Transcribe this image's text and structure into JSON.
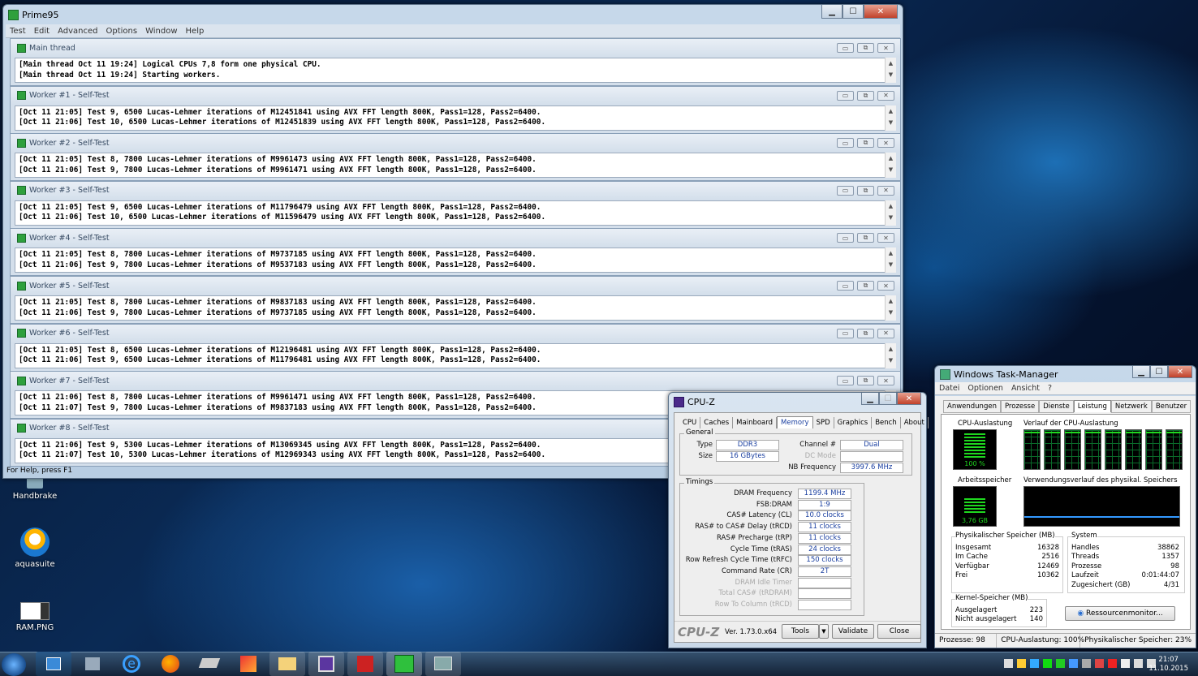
{
  "prime95": {
    "title": "Prime95",
    "menu": [
      "Test",
      "Edit",
      "Advanced",
      "Options",
      "Window",
      "Help"
    ],
    "status": "For Help, press F1",
    "panes": [
      {
        "title": "Main thread",
        "lines": [
          "[Main thread Oct 11 19:24] Logical CPUs 7,8 form one physical CPU.",
          "[Main thread Oct 11 19:24] Starting workers."
        ]
      },
      {
        "title": "Worker #1 - Self-Test",
        "lines": [
          "[Oct 11 21:05] Test 9, 6500 Lucas-Lehmer iterations of M12451841 using AVX FFT length 800K, Pass1=128, Pass2=6400.",
          "[Oct 11 21:06] Test 10, 6500 Lucas-Lehmer iterations of M12451839 using AVX FFT length 800K, Pass1=128, Pass2=6400."
        ]
      },
      {
        "title": "Worker #2 - Self-Test",
        "lines": [
          "[Oct 11 21:05] Test 8, 7800 Lucas-Lehmer iterations of M9961473 using AVX FFT length 800K, Pass1=128, Pass2=6400.",
          "[Oct 11 21:06] Test 9, 7800 Lucas-Lehmer iterations of M9961471 using AVX FFT length 800K, Pass1=128, Pass2=6400."
        ]
      },
      {
        "title": "Worker #3 - Self-Test",
        "lines": [
          "[Oct 11 21:05] Test 9, 6500 Lucas-Lehmer iterations of M11796479 using AVX FFT length 800K, Pass1=128, Pass2=6400.",
          "[Oct 11 21:06] Test 10, 6500 Lucas-Lehmer iterations of M11596479 using AVX FFT length 800K, Pass1=128, Pass2=6400."
        ]
      },
      {
        "title": "Worker #4 - Self-Test",
        "lines": [
          "[Oct 11 21:05] Test 8, 7800 Lucas-Lehmer iterations of M9737185 using AVX FFT length 800K, Pass1=128, Pass2=6400.",
          "[Oct 11 21:06] Test 9, 7800 Lucas-Lehmer iterations of M9537183 using AVX FFT length 800K, Pass1=128, Pass2=6400."
        ]
      },
      {
        "title": "Worker #5 - Self-Test",
        "lines": [
          "[Oct 11 21:05] Test 8, 7800 Lucas-Lehmer iterations of M9837183 using AVX FFT length 800K, Pass1=128, Pass2=6400.",
          "[Oct 11 21:06] Test 9, 7800 Lucas-Lehmer iterations of M9737185 using AVX FFT length 800K, Pass1=128, Pass2=6400."
        ]
      },
      {
        "title": "Worker #6 - Self-Test",
        "lines": [
          "[Oct 11 21:05] Test 8, 6500 Lucas-Lehmer iterations of M12196481 using AVX FFT length 800K, Pass1=128, Pass2=6400.",
          "[Oct 11 21:06] Test 9, 6500 Lucas-Lehmer iterations of M11796481 using AVX FFT length 800K, Pass1=128, Pass2=6400."
        ]
      },
      {
        "title": "Worker #7 - Self-Test",
        "lines": [
          "[Oct 11 21:06] Test 8, 7800 Lucas-Lehmer iterations of M9961471 using AVX FFT length 800K, Pass1=128, Pass2=6400.",
          "[Oct 11 21:07] Test 9, 7800 Lucas-Lehmer iterations of M9837183 using AVX FFT length 800K, Pass1=128, Pass2=6400."
        ]
      },
      {
        "title": "Worker #8 - Self-Test",
        "lines": [
          "[Oct 11 21:06] Test 9, 5300 Lucas-Lehmer iterations of M13069345 using AVX FFT length 800K, Pass1=128, Pass2=6400.",
          "[Oct 11 21:07] Test 10, 5300 Lucas-Lehmer iterations of M12969343 using AVX FFT length 800K, Pass1=128, Pass2=6400."
        ]
      }
    ]
  },
  "desktop": {
    "icons": [
      "Handbrake",
      "aquasuite",
      "RAM.PNG"
    ]
  },
  "cpuz": {
    "title": "CPU-Z",
    "tabs": [
      "CPU",
      "Caches",
      "Mainboard",
      "Memory",
      "SPD",
      "Graphics",
      "Bench",
      "About"
    ],
    "active_tab": "Memory",
    "general_label": "General",
    "type_label": "Type",
    "type": "DDR3",
    "size_label": "Size",
    "size": "16 GBytes",
    "channel_label": "Channel #",
    "channel": "Dual",
    "dc_label": "DC Mode",
    "nb_label": "NB Frequency",
    "nb": "3997.6 MHz",
    "timings_label": "Timings",
    "timings": [
      {
        "label": "DRAM Frequency",
        "value": "1199.4 MHz"
      },
      {
        "label": "FSB:DRAM",
        "value": "1:9"
      },
      {
        "label": "CAS# Latency (CL)",
        "value": "10.0 clocks"
      },
      {
        "label": "RAS# to CAS# Delay (tRCD)",
        "value": "11 clocks"
      },
      {
        "label": "RAS# Precharge (tRP)",
        "value": "11 clocks"
      },
      {
        "label": "Cycle Time (tRAS)",
        "value": "24 clocks"
      },
      {
        "label": "Row Refresh Cycle Time (tRFC)",
        "value": "150 clocks"
      },
      {
        "label": "Command Rate (CR)",
        "value": "2T"
      },
      {
        "label": "DRAM Idle Timer",
        "value": ""
      },
      {
        "label": "Total CAS# (tRDRAM)",
        "value": ""
      },
      {
        "label": "Row To Column (tRCD)",
        "value": ""
      }
    ],
    "brand": "CPU-Z",
    "version": "Ver. 1.73.0.x64",
    "tools": "Tools",
    "validate": "Validate",
    "close": "Close"
  },
  "taskmgr": {
    "title": "Windows Task-Manager",
    "menu": [
      "Datei",
      "Optionen",
      "Ansicht",
      "?"
    ],
    "tabs": [
      "Anwendungen",
      "Prozesse",
      "Dienste",
      "Leistung",
      "Netzwerk",
      "Benutzer"
    ],
    "active_tab": "Leistung",
    "cpu_label": "CPU-Auslastung",
    "cpu_value": "100 %",
    "cpu_hist_label": "Verlauf der CPU-Auslastung",
    "mem_label": "Arbeitsspeicher",
    "mem_value": "3,76 GB",
    "mem_hist_label": "Verwendungsverlauf des physikal. Speichers",
    "phys_label": "Physikalischer Speicher (MB)",
    "phys": [
      {
        "k": "Insgesamt",
        "v": "16328"
      },
      {
        "k": "Im Cache",
        "v": "2516"
      },
      {
        "k": "Verfügbar",
        "v": "12469"
      },
      {
        "k": "Frei",
        "v": "10362"
      }
    ],
    "sys_label": "System",
    "sys": [
      {
        "k": "Handles",
        "v": "38862"
      },
      {
        "k": "Threads",
        "v": "1357"
      },
      {
        "k": "Prozesse",
        "v": "98"
      },
      {
        "k": "Laufzeit",
        "v": "0:01:44:07"
      },
      {
        "k": "Zugesichert (GB)",
        "v": "4/31"
      }
    ],
    "kernel_label": "Kernel-Speicher (MB)",
    "kernel": [
      {
        "k": "Ausgelagert",
        "v": "223"
      },
      {
        "k": "Nicht ausgelagert",
        "v": "140"
      }
    ],
    "resmon": "Ressourcenmonitor...",
    "status": [
      "Prozesse: 98",
      "CPU-Auslastung: 100%",
      "Physikalischer Speicher: 23%"
    ]
  },
  "taskbar": {
    "time": "21:07",
    "date": "11.10.2015"
  }
}
